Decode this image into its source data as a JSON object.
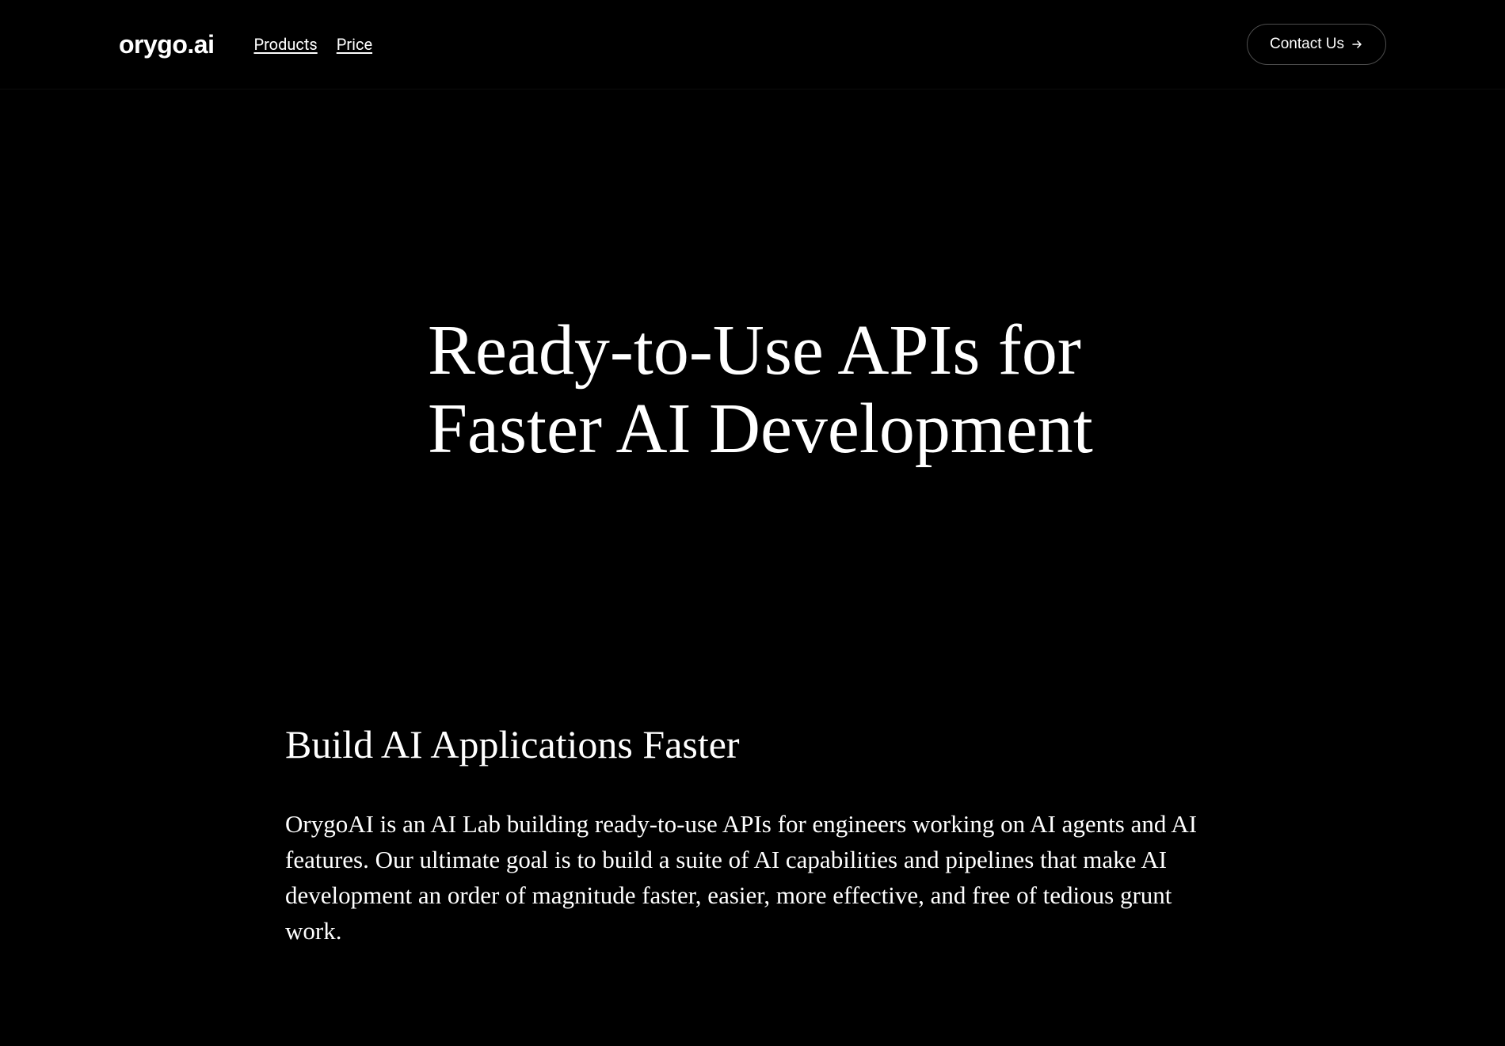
{
  "header": {
    "logo": "orygo.ai",
    "nav": {
      "products": "Products",
      "price": "Price"
    },
    "contact_button": "Contact Us"
  },
  "hero": {
    "title": "Ready-to-Use APIs for Faster AI Development"
  },
  "content": {
    "title": "Build AI Applications Faster",
    "body": "OrygoAI is an AI Lab building ready-to-use APIs for engineers working on AI agents and AI features. Our ultimate goal is to build a suite of AI capabilities and pipelines that make AI development an order of magnitude faster, easier, more effective, and free of tedious grunt work."
  }
}
